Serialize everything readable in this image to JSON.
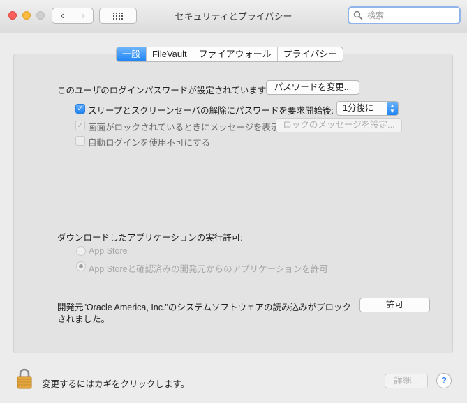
{
  "window": {
    "title": "セキュリティとプライバシー"
  },
  "toolbar": {
    "back_icon": "chevron-left-icon",
    "forward_icon": "chevron-right-icon",
    "show_all_icon": "grid-icon",
    "search": {
      "placeholder": "検索",
      "value": ""
    }
  },
  "tabs": [
    {
      "label": "一般",
      "active": true
    },
    {
      "label": "FileVault",
      "active": false
    },
    {
      "label": "ファイアウォール",
      "active": false
    },
    {
      "label": "プライバシー",
      "active": false
    }
  ],
  "general": {
    "login_password_label": "このユーザのログインパスワードが設定されています",
    "change_password_button": "パスワードを変更...",
    "require_password": {
      "label": "スリープとスクリーンセーバの解除にパスワードを要求",
      "checked": true,
      "after_label": "開始後:",
      "delay_value": "1分後に"
    },
    "show_message": {
      "label": "画面がロックされているときにメッセージを表示",
      "checked": true,
      "enabled": false,
      "button": "ロックのメッセージを設定..."
    },
    "disable_auto_login": {
      "label": "自動ログインを使用不可にする",
      "checked": false,
      "enabled": false
    }
  },
  "downloads": {
    "heading": "ダウンロードしたアプリケーションの実行許可:",
    "options": [
      {
        "label": "App Store",
        "selected": false
      },
      {
        "label": "App Storeと確認済みの開発元からのアプリケーションを許可",
        "selected": true
      }
    ],
    "blocked_message_line1": "開発元\"Oracle America, Inc.\"のシステムソフトウェアの読み込みがブロック",
    "blocked_message_line2": "されました。",
    "allow_button": "許可"
  },
  "footer": {
    "lock_icon": "lock-icon",
    "lock_message": "変更するにはカギをクリックします。",
    "advanced_button": "詳細...",
    "help_label": "?"
  },
  "colors": {
    "accent": "#1f84f5",
    "panel": "#e3e3e3",
    "window": "#ececec"
  }
}
